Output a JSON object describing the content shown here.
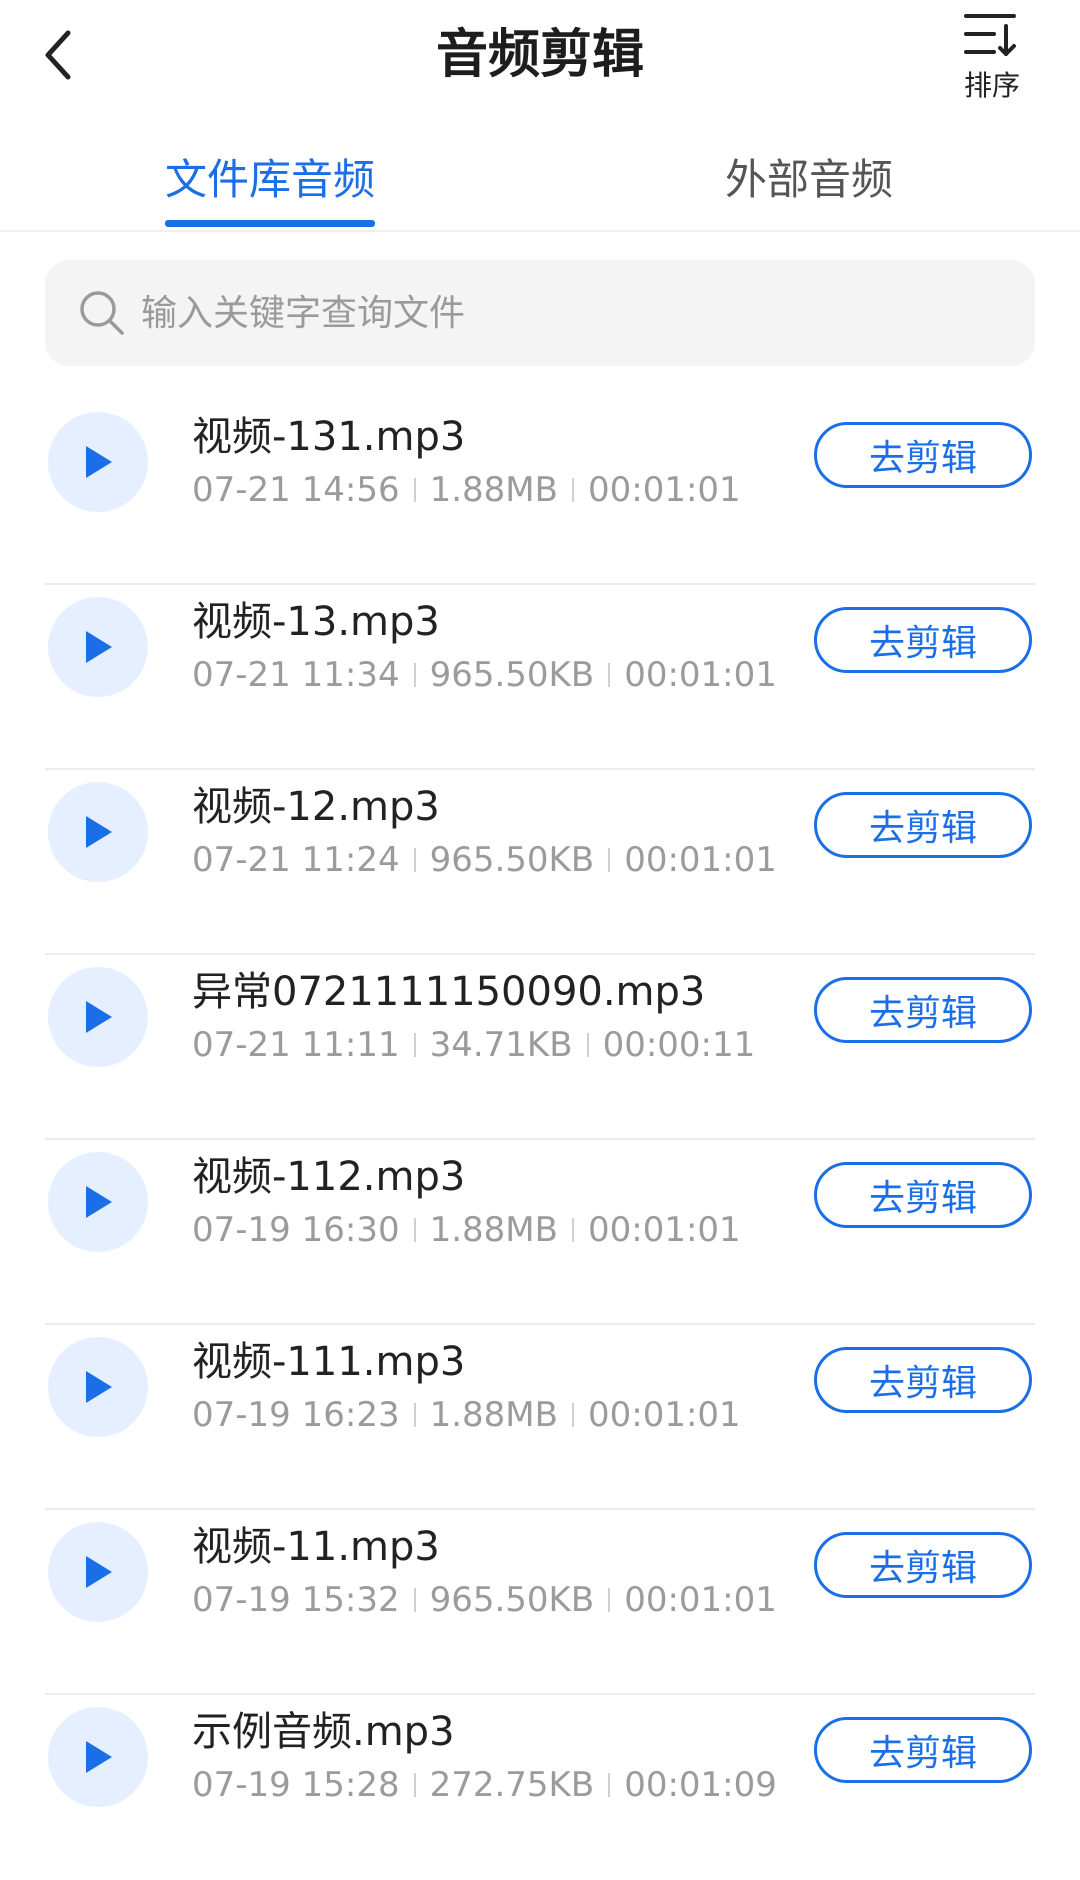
{
  "header": {
    "title": "音频剪辑",
    "sort_label": "排序"
  },
  "tabs": [
    {
      "label": "文件库音频",
      "active": true
    },
    {
      "label": "外部音频",
      "active": false
    }
  ],
  "search": {
    "placeholder": "输入关键字查询文件"
  },
  "colors": {
    "accent": "#1a6fe8",
    "play_bg": "#e5efff"
  },
  "files": [
    {
      "name": "视频-131.mp3",
      "date": "07-21 14:56",
      "size": "1.88MB",
      "duration": "00:01:01",
      "action": "去剪辑"
    },
    {
      "name": "视频-13.mp3",
      "date": "07-21 11:34",
      "size": "965.50KB",
      "duration": "00:01:01",
      "action": "去剪辑"
    },
    {
      "name": "视频-12.mp3",
      "date": "07-21 11:24",
      "size": "965.50KB",
      "duration": "00:01:01",
      "action": "去剪辑"
    },
    {
      "name": "异常0721111150090.mp3",
      "date": "07-21 11:11",
      "size": "34.71KB",
      "duration": "00:00:11",
      "action": "去剪辑"
    },
    {
      "name": "视频-112.mp3",
      "date": "07-19 16:30",
      "size": "1.88MB",
      "duration": "00:01:01",
      "action": "去剪辑"
    },
    {
      "name": "视频-111.mp3",
      "date": "07-19 16:23",
      "size": "1.88MB",
      "duration": "00:01:01",
      "action": "去剪辑"
    },
    {
      "name": "视频-11.mp3",
      "date": "07-19 15:32",
      "size": "965.50KB",
      "duration": "00:01:01",
      "action": "去剪辑"
    },
    {
      "name": "示例音频.mp3",
      "date": "07-19 15:28",
      "size": "272.75KB",
      "duration": "00:01:09",
      "action": "去剪辑"
    }
  ]
}
